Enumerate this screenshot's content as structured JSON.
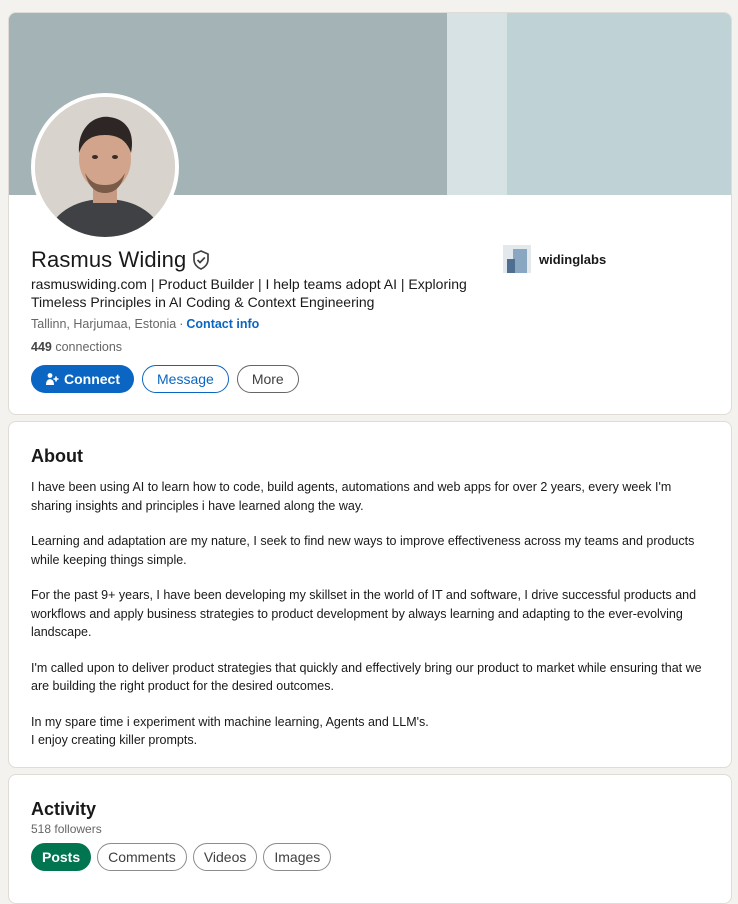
{
  "profile": {
    "name": "Rasmus Widing",
    "headline": "rasmuswiding.com | Product Builder | I help teams adopt AI | Exploring Timeless Principles in AI Coding & Context Engineering",
    "location": "Tallinn, Harjumaa, Estonia",
    "location_separator": "·",
    "contact_info_label": "Contact info",
    "connections_count": "449",
    "connections_label": "connections",
    "verified_icon": "shield-check-icon",
    "company_name": "widinglabs",
    "banner_colors": [
      "#a3b3b6",
      "#d6e2e3",
      "#bfd2d6"
    ]
  },
  "actions": {
    "connect_label": "Connect",
    "message_label": "Message",
    "more_label": "More"
  },
  "about": {
    "title": "About",
    "paragraphs": [
      "I have been using AI to learn how to code, build agents, automations and web apps for over 2 years, every week I'm sharing insights and principles i have learned along the way.",
      "Learning and adaptation are my nature, I seek to find new ways to improve effectiveness across my teams and products while keeping things simple.",
      "For the past 9+ years, I have been developing my skillset in the world of IT and software, I drive successful products and workflows and apply business strategies to product development by always learning and adapting to the ever-evolving landscape.",
      "I'm called upon to deliver product strategies that quickly and effectively bring our product to market while ensuring that we are building the right product for the desired outcomes.",
      "In my spare time i experiment with machine learning, Agents and LLM's.",
      "I enjoy creating killer prompts."
    ]
  },
  "activity": {
    "title": "Activity",
    "followers": "518 followers",
    "tabs": [
      "Posts",
      "Comments",
      "Videos",
      "Images"
    ],
    "active_tab": "Posts"
  },
  "colors": {
    "primary_blue": "#0a66c2",
    "active_green": "#01754f"
  }
}
